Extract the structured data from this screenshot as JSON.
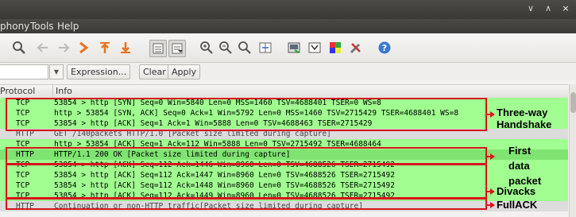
{
  "window": {
    "controls": [
      {
        "name": "minimize",
        "glyph": "∨"
      },
      {
        "name": "maximize",
        "glyph": "∧"
      },
      {
        "name": "close",
        "glyph": "×"
      }
    ]
  },
  "menu": {
    "items": [
      "phony",
      "Tools",
      "Help"
    ]
  },
  "toolbar": {
    "icons": [
      "search-icon",
      "go-back-icon",
      "go-forward-icon",
      "go-to-packet-icon",
      "go-to-first-icon",
      "go-to-last-icon",
      "colorize-icon",
      "auto-scroll-icon",
      "zoom-in-icon",
      "zoom-out-icon",
      "normal-size-icon",
      "resize-columns-icon",
      "capture-filters-icon",
      "display-filters-icon",
      "coloring-rules-icon",
      "preferences-icon",
      "help-icon"
    ]
  },
  "filter": {
    "value": "",
    "expression_label": "Expression...",
    "clear_label": "Clear",
    "apply_label": "Apply"
  },
  "columns": {
    "protocol": "Protocol",
    "info": "Info"
  },
  "colors": {
    "tcp_row": "#a0ff90",
    "http_row": "#dcdcdc",
    "selected_row": "#7fe472",
    "annotation": "#d8141c"
  },
  "packets": [
    {
      "protocol": "TCP",
      "info": "53854 > http [SYN] Seq=0 Win=5840 Len=0 MSS=1460 TSV=4688401 TSER=0 WS=8"
    },
    {
      "protocol": "TCP",
      "info": "http > 53854 [SYN, ACK] Seq=0 Ack=1 Win=5792 Len=0 MSS=1460 TSV=2715429 TSER=4688401 WS=8"
    },
    {
      "protocol": "TCP",
      "info": "53854 > http [ACK] Seq=1 Ack=1 Win=5888 Len=0 TSV=4688463 TSER=2715429"
    },
    {
      "protocol": "HTTP",
      "info": "GET /140packets HTTP/1.0 [Packet size limited during capture]"
    },
    {
      "protocol": "TCP",
      "info": "http > 53854 [ACK] Seq=1 Ack=112 Win=5888 Len=0 TSV=2715492 TSER=4688464"
    },
    {
      "protocol": "HTTP",
      "info": "HTTP/1.1 200 OK [Packet size limited during capture]"
    },
    {
      "protocol": "TCP",
      "info": "53854 > http [ACK] Seq=112 Ack=1446 Win=8960 Len=0 TSV=4688526 TSER=2715492"
    },
    {
      "protocol": "TCP",
      "info": "53854 > http [ACK] Seq=112 Ack=1447 Win=8960 Len=0 TSV=4688526 TSER=2715492"
    },
    {
      "protocol": "TCP",
      "info": "53854 > http [ACK] Seq=112 Ack=1448 Win=8960 Len=0 TSV=4688526 TSER=2715492"
    },
    {
      "protocol": "TCP",
      "info": "53854 > http [ACK] Seq=112 Ack=1449 Win=8960 Len=0 TSV=4688526 TSER=2715492"
    },
    {
      "protocol": "HTTP",
      "info": "Continuation or non-HTTP traffic[Packet size limited during capture]"
    }
  ],
  "annotations": {
    "handshake": [
      "Three-way",
      "Handshake"
    ],
    "first_data": [
      "First",
      "data",
      "packet"
    ],
    "divacks": "Divacks",
    "fullack": "FullACK"
  }
}
